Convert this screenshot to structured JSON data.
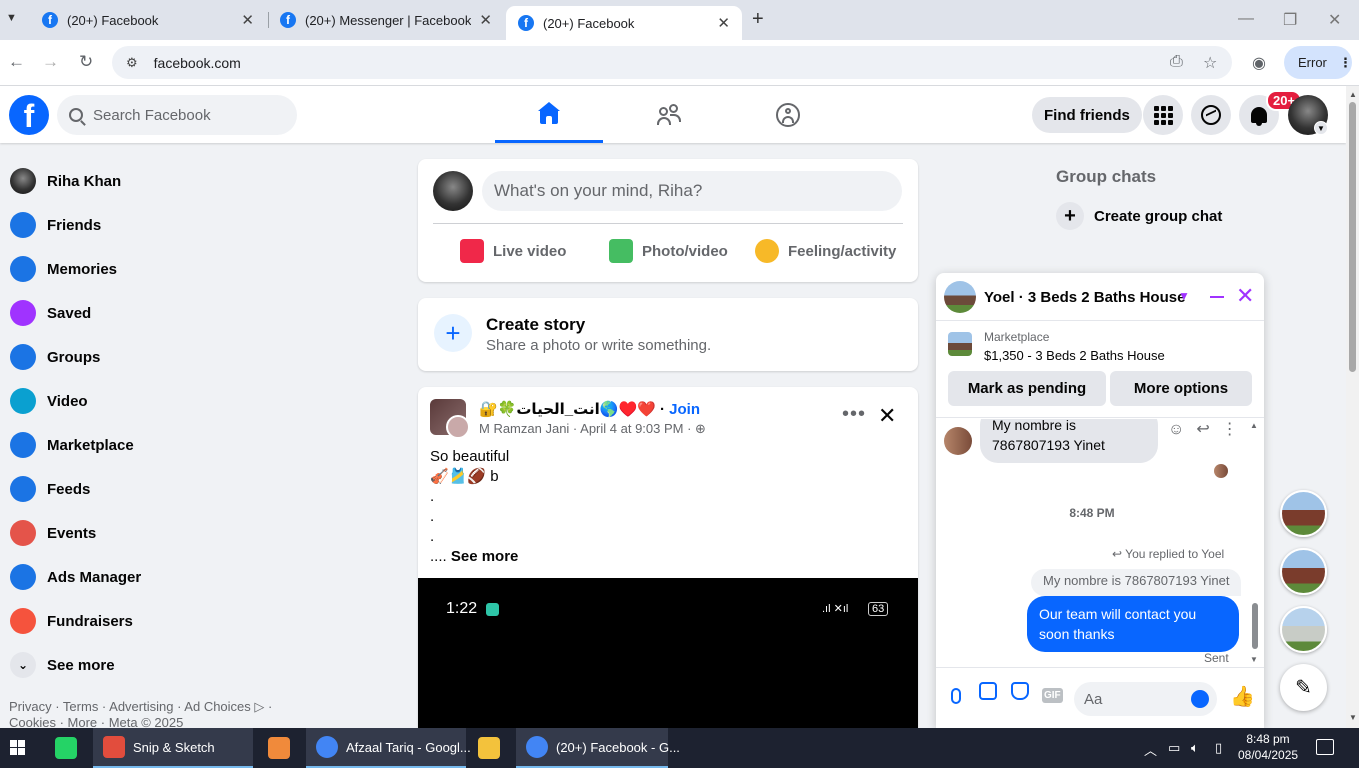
{
  "browser": {
    "tabs": [
      {
        "title": "(20+) Facebook"
      },
      {
        "title": "(20+) Messenger | Facebook"
      },
      {
        "title": "(20+) Facebook"
      }
    ],
    "url": "facebook.com",
    "error_label": "Error"
  },
  "fb_header": {
    "logo": "f",
    "search_placeholder": "Search Facebook",
    "find_friends": "Find friends",
    "notif_badge": "20+"
  },
  "left_nav": {
    "items": [
      {
        "label": "Riha Khan",
        "icon": "profile-avatar",
        "color": "#333333"
      },
      {
        "label": "Friends",
        "icon": "friends-icon",
        "color": "#1b74e4"
      },
      {
        "label": "Memories",
        "icon": "clock-icon",
        "color": "#1b74e4"
      },
      {
        "label": "Saved",
        "icon": "bookmark-icon",
        "color": "#a033ff"
      },
      {
        "label": "Groups",
        "icon": "groups-icon",
        "color": "#1b74e4"
      },
      {
        "label": "Video",
        "icon": "video-icon",
        "color": "#0aa0d0"
      },
      {
        "label": "Marketplace",
        "icon": "marketplace-icon",
        "color": "#1b74e4"
      },
      {
        "label": "Feeds",
        "icon": "feeds-icon",
        "color": "#1b74e4"
      },
      {
        "label": "Events",
        "icon": "events-icon",
        "color": "#e4544a"
      },
      {
        "label": "Ads Manager",
        "icon": "ads-manager-icon",
        "color": "#1b74e4"
      },
      {
        "label": "Fundraisers",
        "icon": "heart-icon",
        "color": "#f5533d"
      },
      {
        "label": "See more",
        "icon": "chevron-down-icon",
        "color": "#050505"
      }
    ],
    "footer": "Privacy · Terms · Advertising · Ad Choices ▷ · Cookies · More · Meta © 2025"
  },
  "composer": {
    "placeholder": "What's on your mind, Riha?",
    "actions": [
      "Live video",
      "Photo/video",
      "Feeling/activity"
    ]
  },
  "story": {
    "title": "Create story",
    "subtitle": "Share a photo or write something."
  },
  "post": {
    "group_name": "🔐🍀انت_الحيات🌎♥️❤️",
    "join": "Join",
    "author": "M Ramzan Jani",
    "date": "April 4 at 9:03 PM",
    "text": "So beautiful\n🎻🎽🏈 b\n.\n.\n.\n.... ",
    "see_more": "See more",
    "video_time": "1:22",
    "video_signal": ".ıl ✕ıl",
    "video_battery": "63"
  },
  "right_col": {
    "group_chats_title": "Group chats",
    "create_group_chat": "Create group chat"
  },
  "chat": {
    "name": "Yoel · 3 Beds 2 Baths House",
    "marketplace_label": "Marketplace",
    "listing": "$1,350 - 3 Beds 2 Baths House",
    "btn_pending": "Mark as pending",
    "btn_more": "More options",
    "incoming": "My nombre is 7867807193 Yinet",
    "timestamp": "8:48 PM",
    "replied_to": "You replied to Yoel",
    "quoted": "My nombre is 7867807193 Yinet",
    "outgoing": "Our team will contact you soon thanks",
    "sent": "Sent",
    "input_placeholder": "Aa",
    "accent": "#a033ff",
    "bubble_color": "#0866ff"
  },
  "taskbar": {
    "items": [
      {
        "label": "",
        "icon": "whatsapp-icon",
        "color": "#25d366"
      },
      {
        "label": "Snip & Sketch",
        "icon": "snip-sketch-icon",
        "color": "#e24d3d"
      },
      {
        "label": "",
        "icon": "sublime-icon",
        "color": "#f08a3b"
      },
      {
        "label": "Afzaal Tariq - Googl...",
        "icon": "chrome-icon",
        "color": "#4285f4"
      },
      {
        "label": "",
        "icon": "folder-icon",
        "color": "#f3c23c"
      },
      {
        "label": "(20+) Facebook - G...",
        "icon": "chrome-icon",
        "color": "#4285f4"
      }
    ],
    "time": "8:48 pm",
    "date": "08/04/2025"
  }
}
